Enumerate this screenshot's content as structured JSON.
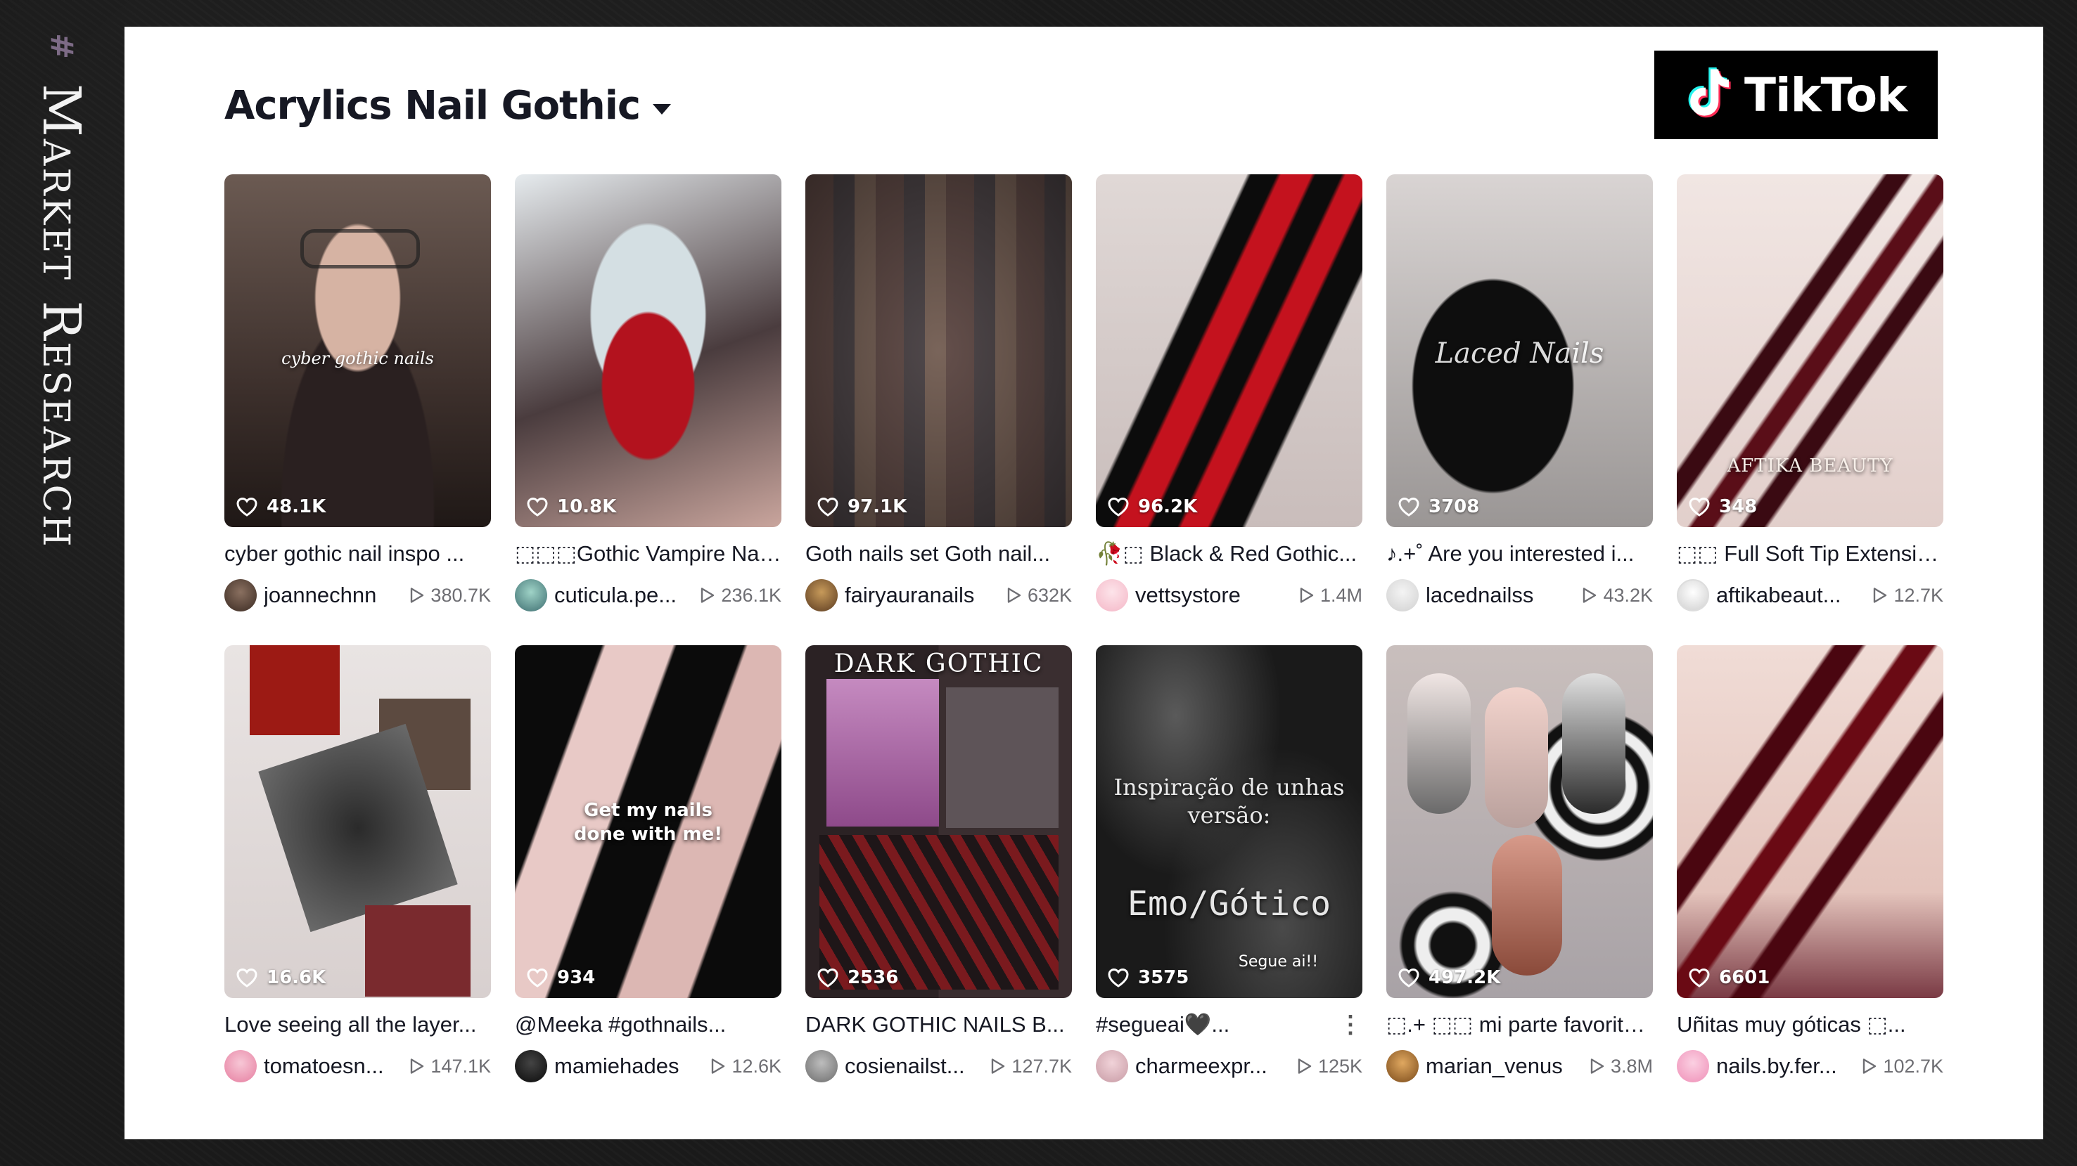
{
  "side": {
    "hash": "#",
    "label": "Market Research"
  },
  "header": {
    "title": "Acrylics Nail Gothic",
    "logo_text": "TikTok"
  },
  "videos": [
    {
      "caption": "cyber gothic nail inspo ...",
      "user": "joannechnn",
      "views": "380.7K",
      "likes": "48.1K",
      "overlay": "cyber gothic nails"
    },
    {
      "caption": "⬚⬚⬚Gothic Vampire Nail...",
      "user": "cuticula.pe...",
      "views": "236.1K",
      "likes": "10.8K",
      "overlay": ""
    },
    {
      "caption": "Goth nails set Goth nail...",
      "user": "fairyauranails",
      "views": "632K",
      "likes": "97.1K",
      "overlay": ""
    },
    {
      "caption": "🥀⬚ Black & Red Gothic...",
      "user": "vettsystore",
      "views": "1.4M",
      "likes": "96.2K",
      "overlay": ""
    },
    {
      "caption": "♪.+˚ Are you interested i...",
      "user": "lacednailss",
      "views": "43.2K",
      "likes": "3708",
      "overlay": "Laced Nails"
    },
    {
      "caption": "⬚⬚ Full Soft Tip Extensio...",
      "user": "aftikabeaut...",
      "views": "12.7K",
      "likes": "348",
      "overlay": "AFTIKA BEAUTY"
    },
    {
      "caption": "Love seeing all the layer...",
      "user": "tomatoesn...",
      "views": "147.1K",
      "likes": "16.6K",
      "overlay": ""
    },
    {
      "caption": "@Meeka #gothnails...",
      "user": "mamiehades",
      "views": "12.6K",
      "likes": "934",
      "overlay": "Get my nails done with me!"
    },
    {
      "caption": "DARK GOTHIC NAILS B...",
      "user": "cosienailst...",
      "views": "127.7K",
      "likes": "2536",
      "overlay": "DARK GOTHIC"
    },
    {
      "caption": "#segueai🖤...",
      "user": "charmeexpr...",
      "views": "125K",
      "likes": "3575",
      "overlay": "Inspiração de unhas versão:",
      "overlay2": "Emo/Gótico",
      "overlay3": "Segue ai!!"
    },
    {
      "caption": "⬚.+ ⬚⬚ mi parte favorita...",
      "user": "marian_venus",
      "views": "3.8M",
      "likes": "497.2K",
      "overlay": ""
    },
    {
      "caption": "Uñitas muy góticas ⬚...",
      "user": "nails.by.fer...",
      "views": "102.7K",
      "likes": "6601",
      "overlay": ""
    }
  ],
  "icons": {
    "heart": "heart-outline-icon",
    "play": "play-outline-icon",
    "more": "more-vertical-icon"
  },
  "colors": {
    "accent": "#fe2c55",
    "background": "#ffffff",
    "text": "#161823",
    "muted": "#6e6e73"
  }
}
